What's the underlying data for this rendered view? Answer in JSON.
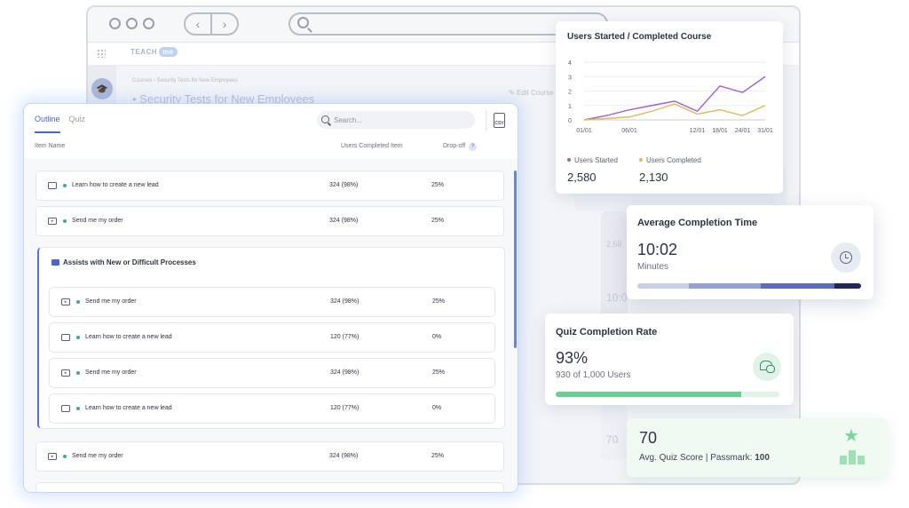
{
  "app": {
    "brand": "TEACH",
    "brand_badge": "me"
  },
  "background": {
    "breadcrumb": "Courses  ›  Security Tests for New Employees",
    "title": "Security Tests for New Employees",
    "edit_course": "Edit Course"
  },
  "outline": {
    "tabs": [
      {
        "label": "Outline",
        "active": true
      },
      {
        "label": "Quiz",
        "active": false
      }
    ],
    "search": {
      "placeholder": "Search..."
    },
    "csv_label": "CSV",
    "columns": {
      "name": "Item Name",
      "completed": "Users Completed Item",
      "dropoff": "Drop-off",
      "help": "?"
    },
    "rows_top": [
      {
        "icon": "walkthrough-icon",
        "name": "Learn how to create a new lead",
        "completed": "324 (98%)",
        "dropoff": "25%"
      },
      {
        "icon": "video-icon",
        "name": "Send me my order",
        "completed": "324 (98%)",
        "dropoff": "25%"
      }
    ],
    "group": {
      "title": "Assists with New or Difficult Processes",
      "rows": [
        {
          "icon": "video-icon",
          "name": "Send me my order",
          "completed": "324 (98%)",
          "dropoff": "25%"
        },
        {
          "icon": "walkthrough-icon",
          "name": "Learn how to create a new lead",
          "completed": "120 (77%)",
          "dropoff": "0%"
        },
        {
          "icon": "video-icon",
          "name": "Send me my order",
          "completed": "324 (98%)",
          "dropoff": "25%"
        },
        {
          "icon": "walkthrough-icon",
          "name": "Learn how to create a new lead",
          "completed": "120 (77%)",
          "dropoff": "0%"
        }
      ]
    },
    "rows_bottom": [
      {
        "icon": "video-icon",
        "name": "Send me my order",
        "completed": "324 (98%)",
        "dropoff": "25%"
      }
    ]
  },
  "users_chart": {
    "title": "Users Started / Completed Course",
    "legend_started": "Users Started",
    "legend_completed": "Users Completed",
    "started_total": "2,580",
    "completed_total": "2,130"
  },
  "chart_data": {
    "type": "line",
    "title": "Users Started / Completed Course",
    "x": [
      "01/01",
      "03/01",
      "06/01",
      "09/01",
      "11/01",
      "12/01",
      "18/01",
      "24/01",
      "31/01"
    ],
    "x_ticks": [
      "01/01",
      "06/01",
      "12/01",
      "18/01",
      "24/01",
      "31/01"
    ],
    "y_ticks": [
      0,
      1,
      2,
      3,
      4
    ],
    "ylim": [
      0,
      4
    ],
    "grid": true,
    "series": [
      {
        "name": "Users Started",
        "color": "#a45fce",
        "values": [
          0,
          0.3,
          0.7,
          1.0,
          1.3,
          0.6,
          2.35,
          1.9,
          3.0
        ]
      },
      {
        "name": "Users Completed",
        "color": "#e2b95a",
        "values": [
          0,
          0.1,
          0.2,
          0.6,
          1.1,
          0.4,
          0.7,
          0.3,
          1.0
        ]
      }
    ]
  },
  "avg_completion": {
    "title": "Average Completion Time",
    "value": "10:02",
    "unit": "Minutes",
    "segments": [
      {
        "fraction": 0.23,
        "color": "#c8d0e8"
      },
      {
        "fraction": 0.32,
        "color": "#93a1d6"
      },
      {
        "fraction": 0.33,
        "color": "#5b6bc4"
      },
      {
        "fraction": 0.12,
        "color": "#1f2658"
      }
    ]
  },
  "quiz_completion": {
    "title": "Quiz Completion Rate",
    "value": "93%",
    "detail": "930 of 1,000 Users",
    "progress": 0.83
  },
  "quiz_score": {
    "value": "70",
    "label": "Avg. Quiz Score | Passmark: ",
    "passmark": "100"
  },
  "colors": {
    "accent": "#4a63d8",
    "success": "#3bb37a"
  }
}
